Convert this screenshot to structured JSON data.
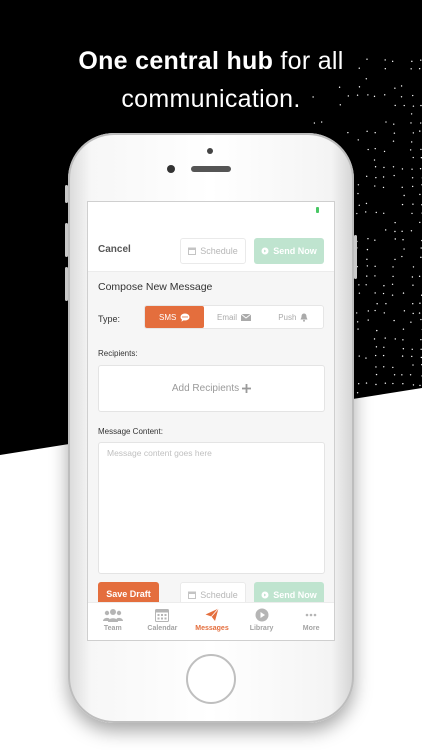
{
  "headline": {
    "bold": "One central hub",
    "rest": "for all",
    "line2": "communication."
  },
  "nav": {
    "cancel": "Cancel",
    "schedule": "Schedule",
    "send_now": "Send Now"
  },
  "compose": {
    "title": "Compose New Message",
    "type_label": "Type:",
    "types": [
      {
        "label": "SMS",
        "icon": "chat-bubble-icon",
        "selected": true
      },
      {
        "label": "Email",
        "icon": "envelope-icon",
        "selected": false
      },
      {
        "label": "Push",
        "icon": "bell-icon",
        "selected": false
      }
    ],
    "recipients_label": "Recipients:",
    "add_recipients": "Add Recipients",
    "content_label": "Message Content:",
    "content_placeholder": "Message content goes here"
  },
  "footer": {
    "save_draft": "Save Draft",
    "schedule": "Schedule",
    "send_now": "Send Now"
  },
  "tabs": [
    {
      "label": "Team",
      "icon": "team-icon"
    },
    {
      "label": "Calendar",
      "icon": "calendar-icon"
    },
    {
      "label": "Messages",
      "icon": "paper-plane-icon",
      "active": true
    },
    {
      "label": "Library",
      "icon": "play-circle-icon"
    },
    {
      "label": "More",
      "icon": "more-icon"
    }
  ],
  "colors": {
    "accent": "#e46e3d",
    "send_disabled": "#bfe4cf",
    "background": "#000000"
  }
}
